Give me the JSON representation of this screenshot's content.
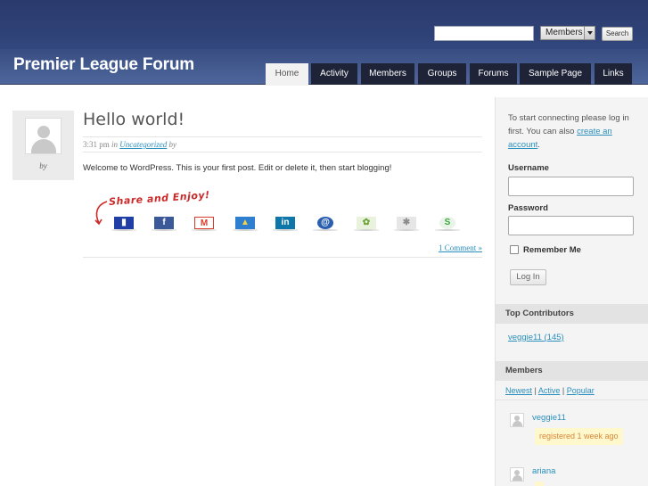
{
  "header": {
    "site_title": "Premier League Forum",
    "search": {
      "input_value": "",
      "select_value": "Members",
      "button_label": "Search"
    },
    "nav": [
      {
        "label": "Home",
        "active": true
      },
      {
        "label": "Activity",
        "active": false
      },
      {
        "label": "Members",
        "active": false
      },
      {
        "label": "Groups",
        "active": false
      },
      {
        "label": "Forums",
        "active": false
      },
      {
        "label": "Sample Page",
        "active": false
      },
      {
        "label": "Links",
        "active": false
      }
    ]
  },
  "post": {
    "author_by": "by",
    "title": "Hello world!",
    "meta": {
      "time": "3:31 pm",
      "in_word": "in",
      "category": "Uncategorized",
      "by_word": "by"
    },
    "body": "Welcome to WordPress. This is your first post. Edit or delete it, then start blogging!",
    "share": {
      "title": "Share and Enjoy!",
      "icons": [
        {
          "icon": "print-icon",
          "color": "#1f3fa6",
          "glyph": "▮"
        },
        {
          "icon": "facebook-icon",
          "color": "#3b5998",
          "glyph": "f"
        },
        {
          "icon": "gmail-icon",
          "color": "#d93b2b",
          "glyph": "M"
        },
        {
          "icon": "photo-share-icon",
          "color": "#2f7fd0",
          "glyph": "▲"
        },
        {
          "icon": "linkedin-icon",
          "color": "#0e76a8",
          "glyph": "in"
        },
        {
          "icon": "email-icon",
          "color": "#2a5fb0",
          "glyph": "@"
        },
        {
          "icon": "leaf-icon",
          "color": "#6ea13a",
          "glyph": "✿"
        },
        {
          "icon": "digg-icon",
          "color": "#8d8d8d",
          "glyph": "✱"
        },
        {
          "icon": "stumble-icon",
          "color": "#3fa33f",
          "glyph": "S"
        }
      ]
    },
    "comments_link": "1 Comment »"
  },
  "sidebar": {
    "login_prompt": "To start connecting please log in first. You can also",
    "create_account_link": "create an account",
    "login_prompt_end": ".",
    "username_label": "Username",
    "username_value": "",
    "password_label": "Password",
    "password_value": "",
    "remember_label": "Remember Me",
    "remember_checked": false,
    "login_button": "Log In",
    "top_contributors": {
      "title": "Top Contributors",
      "items": [
        {
          "label": "veggie11 (145)"
        }
      ]
    },
    "members": {
      "title": "Members",
      "filters": {
        "newest": "Newest",
        "active": "Active",
        "popular": "Popular",
        "separator": " | "
      },
      "items": [
        {
          "name": "veggie11",
          "badge": "registered 1 week ago"
        },
        {
          "name": "ariana",
          "badge": ""
        }
      ]
    }
  }
}
